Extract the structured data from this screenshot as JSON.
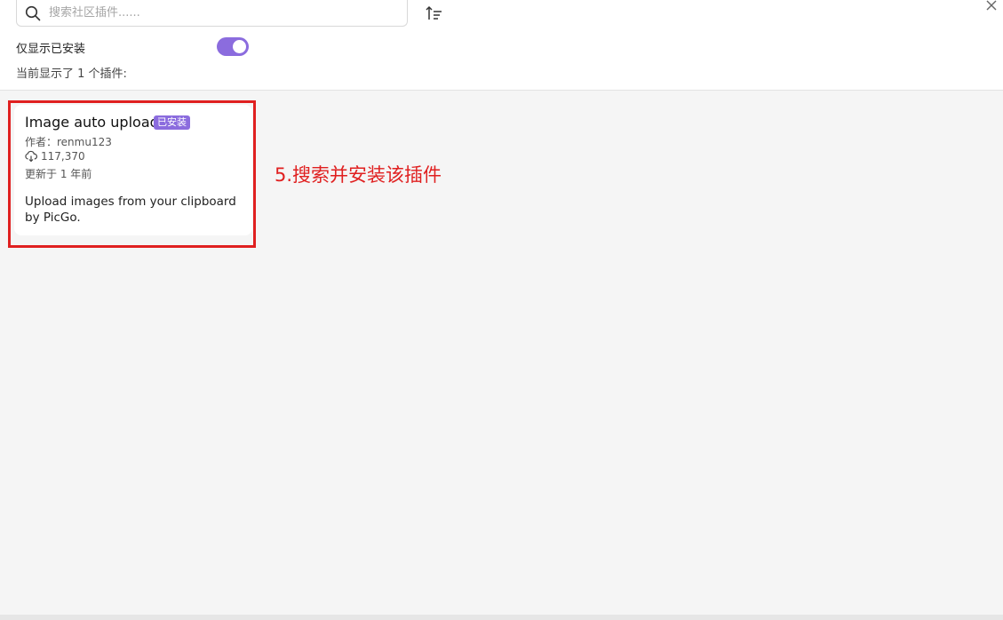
{
  "search": {
    "placeholder": "搜索社区插件......",
    "value": ""
  },
  "toolbar": {
    "sort_icon": "sort-icon",
    "close_icon": "close-icon"
  },
  "filter": {
    "installed_only_label": "仅显示已安装",
    "installed_only_on": true,
    "count_text": "当前显示了 1 个插件:"
  },
  "plugins": [
    {
      "name": "Image auto upload",
      "badge": "已安装",
      "author": "作者：renmu123",
      "downloads": "117,370",
      "updated": "更新于 1 年前",
      "description": "Upload images from your clipboard by PicGo."
    }
  ],
  "annotation": {
    "text": "5.搜索并安装该插件"
  },
  "colors": {
    "accent": "#8b6cde",
    "annotation_red": "#e02020"
  }
}
